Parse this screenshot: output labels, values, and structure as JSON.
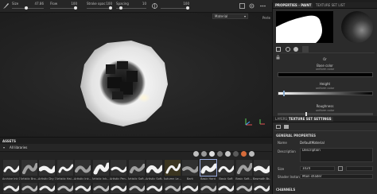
{
  "toolbar": {
    "size_label": "Size",
    "size_value": "47.86",
    "size_fraction": 0.45,
    "flow_label": "Flow",
    "flow_value": "100",
    "flow_fraction": 1.0,
    "stroke_opacity_label": "Stroke opac",
    "stroke_opacity_value": "100",
    "stroke_opacity_fraction": 1.0,
    "spacing_label": "Spacing",
    "spacing_value": "10",
    "spacing_fraction": 0.12,
    "extra_value": "100",
    "extra_fraction": 1.0,
    "icons": [
      "brush-icon",
      "symmetry-icon",
      "lazy-mouse-icon",
      "more-icon"
    ]
  },
  "viewport": {
    "dropdown_value": "Material",
    "right_label": "Perle",
    "gizmo_axes": [
      "x",
      "y",
      "z"
    ]
  },
  "properties": {
    "tabs": [
      "PROPERTIES - PAINT",
      "TEXTURE SET LIST"
    ],
    "channels": [
      {
        "title": "Base color",
        "subtitle": "uniform color"
      },
      {
        "title": "Height",
        "subtitle": "uniform color"
      },
      {
        "title": "Roughness",
        "subtitle": "uniform color"
      }
    ],
    "height_fraction": 0.05,
    "roughness_fraction": 0.3,
    "or_label": "Or"
  },
  "layers": {
    "tabs": [
      "LAYERS",
      "TEXTURE SET SETTINGS"
    ],
    "section": "GENERAL PROPERTIES",
    "name_label": "Name",
    "name_value": "DefaultMaterial",
    "description_label": "Description",
    "description_value": "Description",
    "size_label": "Size",
    "size_value": "1024",
    "shader_label": "Shader Instance",
    "shader_value": "Main shader",
    "channels_label": "CHANNELS"
  },
  "assets": {
    "title": "ASSETS",
    "library": "All libraries",
    "items": [
      "Archive Ink 01",
      "Artistic Bro...",
      "Artistic Dry 1",
      "Artistic Hai...",
      "Artistic Ink...",
      "Artistic Ink...",
      "Artistic Pen...",
      "Artistic Soft...",
      "Artistic Soft...",
      "Autumn Le...",
      "Bark",
      "Basic Hard",
      "Basic Soft",
      "Basic Soft...",
      "Basmoth Br..."
    ],
    "selected_index": 11,
    "filter_colors": [
      "#bfbfbf",
      "#9a9a9a",
      "#e0e0e0",
      "#7a7a7a",
      "#c9c9c9",
      "#5a5a5a",
      "#d66b3a",
      "#bbbbbb"
    ]
  }
}
